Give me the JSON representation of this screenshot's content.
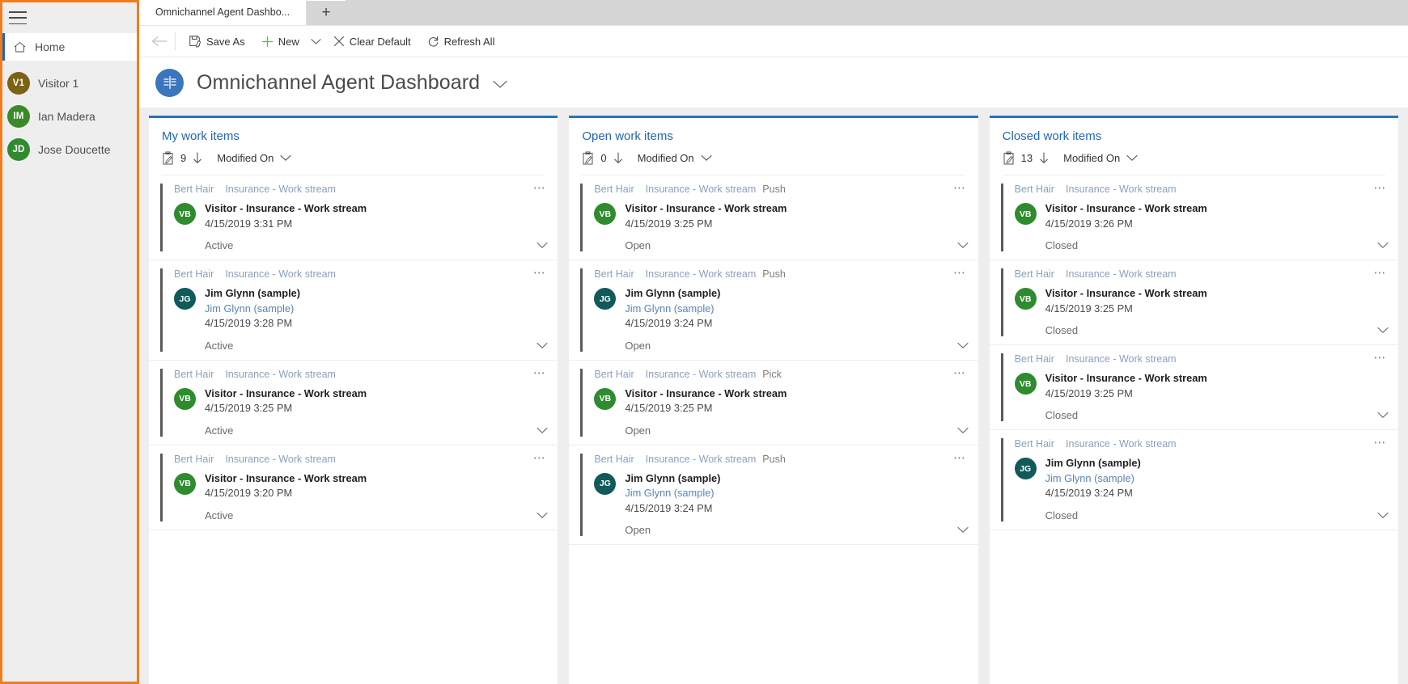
{
  "sidebar": {
    "hamburger_icon": "hamburger-menu-icon",
    "home": {
      "label": "Home",
      "icon": "house-icon"
    },
    "people": [
      {
        "initials": "V1",
        "name": "Visitor 1",
        "color": "#7b6214"
      },
      {
        "initials": "IM",
        "name": "Ian Madera",
        "color": "#3a8a28"
      },
      {
        "initials": "JD",
        "name": "Jose Doucette",
        "color": "#2e8b2e"
      }
    ]
  },
  "tabs": {
    "items": [
      {
        "label": "Omnichannel Agent Dashbo...",
        "active": true
      }
    ],
    "new_tab_label": "+"
  },
  "commandbar": {
    "back_icon": "back-arrow-icon",
    "save_as": "Save As",
    "new": "New",
    "clear_default": "Clear Default",
    "refresh_all": "Refresh All"
  },
  "page": {
    "title": "Omnichannel Agent Dashboard",
    "icon": "dashboard-icon",
    "accent": "#2b72b8"
  },
  "streams": [
    {
      "title": "My work items",
      "count": "9",
      "sort": "Modified On",
      "items": [
        {
          "owner": "Bert Hair",
          "workstream": "Insurance - Work stream",
          "mode": "",
          "initials": "VB",
          "avatar_color": "#2e8b2e",
          "title": "Visitor - Insurance - Work stream",
          "sub": "",
          "time": "4/15/2019 3:31 PM",
          "status": "Active"
        },
        {
          "owner": "Bert Hair",
          "workstream": "Insurance - Work stream",
          "mode": "",
          "initials": "JG",
          "avatar_color": "#11595b",
          "title": "Jim Glynn (sample)",
          "sub": "Jim Glynn (sample)",
          "time": "4/15/2019 3:28 PM",
          "status": "Active"
        },
        {
          "owner": "Bert Hair",
          "workstream": "Insurance - Work stream",
          "mode": "",
          "initials": "VB",
          "avatar_color": "#2e8b2e",
          "title": "Visitor - Insurance - Work stream",
          "sub": "",
          "time": "4/15/2019 3:25 PM",
          "status": "Active"
        },
        {
          "owner": "Bert Hair",
          "workstream": "Insurance - Work stream",
          "mode": "",
          "initials": "VB",
          "avatar_color": "#2e8b2e",
          "title": "Visitor - Insurance - Work stream",
          "sub": "",
          "time": "4/15/2019 3:20 PM",
          "status": "Active"
        }
      ]
    },
    {
      "title": "Open work items",
      "count": "0",
      "sort": "Modified On",
      "items": [
        {
          "owner": "Bert Hair",
          "workstream": "Insurance - Work stream",
          "mode": "Push",
          "initials": "VB",
          "avatar_color": "#2e8b2e",
          "title": "Visitor - Insurance - Work stream",
          "sub": "",
          "time": "4/15/2019 3:25 PM",
          "status": "Open"
        },
        {
          "owner": "Bert Hair",
          "workstream": "Insurance - Work stream",
          "mode": "Push",
          "initials": "JG",
          "avatar_color": "#11595b",
          "title": "Jim Glynn (sample)",
          "sub": "Jim Glynn (sample)",
          "time": "4/15/2019 3:24 PM",
          "status": "Open"
        },
        {
          "owner": "Bert Hair",
          "workstream": "Insurance - Work stream",
          "mode": "Pick",
          "initials": "VB",
          "avatar_color": "#2e8b2e",
          "title": "Visitor - Insurance - Work stream",
          "sub": "",
          "time": "4/15/2019 3:25 PM",
          "status": "Open"
        },
        {
          "owner": "Bert Hair",
          "workstream": "Insurance - Work stream",
          "mode": "Push",
          "initials": "JG",
          "avatar_color": "#11595b",
          "title": "Jim Glynn (sample)",
          "sub": "Jim Glynn (sample)",
          "time": "4/15/2019 3:24 PM",
          "status": "Open"
        }
      ]
    },
    {
      "title": "Closed work items",
      "count": "13",
      "sort": "Modified On",
      "items": [
        {
          "owner": "Bert Hair",
          "workstream": "Insurance - Work stream",
          "mode": "",
          "initials": "VB",
          "avatar_color": "#2e8b2e",
          "title": "Visitor - Insurance - Work stream",
          "sub": "",
          "time": "4/15/2019 3:26 PM",
          "status": "Closed"
        },
        {
          "owner": "Bert Hair",
          "workstream": "Insurance - Work stream",
          "mode": "",
          "initials": "VB",
          "avatar_color": "#2e8b2e",
          "title": "Visitor - Insurance - Work stream",
          "sub": "",
          "time": "4/15/2019 3:25 PM",
          "status": "Closed"
        },
        {
          "owner": "Bert Hair",
          "workstream": "Insurance - Work stream",
          "mode": "",
          "initials": "VB",
          "avatar_color": "#2e8b2e",
          "title": "Visitor - Insurance - Work stream",
          "sub": "",
          "time": "4/15/2019 3:25 PM",
          "status": "Closed"
        },
        {
          "owner": "Bert Hair",
          "workstream": "Insurance - Work stream",
          "mode": "",
          "initials": "JG",
          "avatar_color": "#11595b",
          "title": "Jim Glynn (sample)",
          "sub": "Jim Glynn (sample)",
          "time": "4/15/2019 3:24 PM",
          "status": "Closed"
        }
      ]
    }
  ]
}
